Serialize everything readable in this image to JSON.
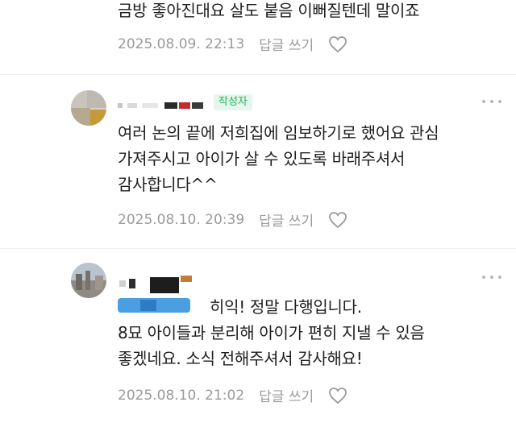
{
  "comments": [
    {
      "lines": [
        "금방 좋아진대요 살도 붙음 이뻐질텐데 말이죠"
      ],
      "date": "2025.08.09. 22:13",
      "reply_label": "답글 쓰기"
    },
    {
      "author_badge": "작성자",
      "lines": [
        "여러 논의 끝에 저희집에 임보하기로 했어요 관심",
        "가져주시고 아이가 살 수 있도록 바래주셔서",
        "감사합니다^^"
      ],
      "date": "2025.08.10. 20:39",
      "reply_label": "답글 쓰기"
    },
    {
      "lines": [
        "히익! 정말 다행입니다.",
        "8묘 아이들과 분리해 아이가 편히 지낼 수 있음",
        "좋겠네요. 소식 전해주셔서 감사해요!"
      ],
      "date": "2025.08.10. 21:02",
      "reply_label": "답글 쓰기"
    }
  ],
  "icons": {
    "like": "heart-icon",
    "more": "more-dots-icon"
  },
  "colors": {
    "text": "#1e1e1e",
    "meta": "#9a9a9a",
    "badge_text": "#22b35b",
    "badge_bg": "#e7f6ec"
  }
}
